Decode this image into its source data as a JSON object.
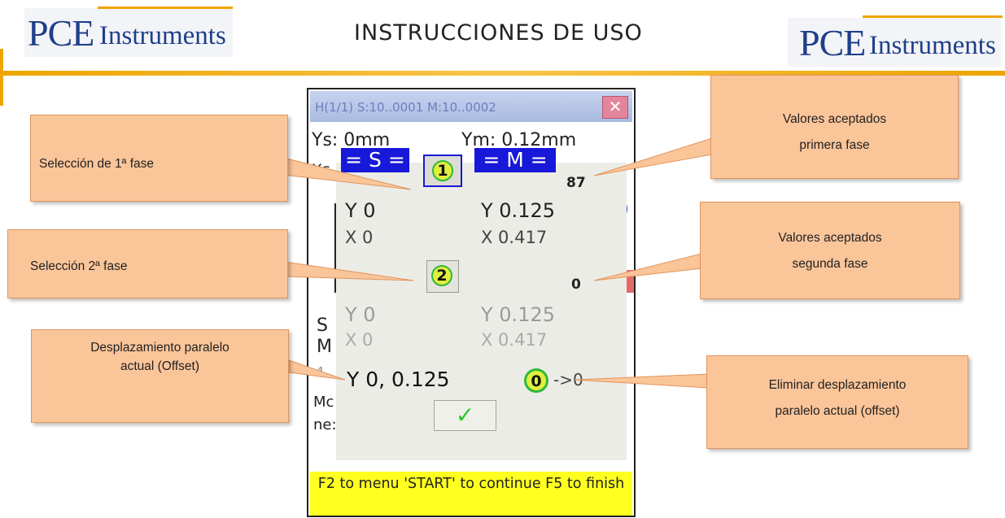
{
  "header": {
    "logo_left": {
      "main": "PCE",
      "sub": "Instruments"
    },
    "title": "INSTRUCCIONES DE USO",
    "logo_right": {
      "main": "PCE",
      "sub": "Instruments"
    }
  },
  "device": {
    "title_bar": "H(1/1) S:10..0001 M:10..0002",
    "close_glyph": "✕",
    "ys": "Ys: 0mm",
    "ym": "Ym: 0.12mm",
    "xs": "Xs",
    "side_s": "S",
    "side_m": "M",
    "side_4": "4.",
    "side_mo": "Mc",
    "side_ne": "ne:",
    "footer": "F2 to menu 'START' to continue F5 to finish",
    "colors": {
      "footer_bg": "#ffff20",
      "titlebar": "#b8c6e8"
    }
  },
  "dialog": {
    "s_label": "= S =",
    "m_label": "= M =",
    "phase1_number": "1",
    "phase1_count": "87",
    "phase1_y_s": "Y 0",
    "phase1_y_m": "Y 0.125",
    "phase1_x_s": "X 0",
    "phase1_x_m": "X 0.417",
    "phase2_number": "2",
    "phase2_count": "0",
    "phase2_y_s": "Y 0",
    "phase2_y_m": "Y 0.125",
    "phase2_x_s": "X 0",
    "phase2_x_m": "X 0.417",
    "offset_value": "Y 0, 0.125",
    "zero_label": "0",
    "zero_arrow": "->0",
    "confirm_glyph": "✓",
    "colors": {
      "blue_button": "#1818d8",
      "phase_circle": "#e0ef3c",
      "check": "#2ec62e"
    }
  },
  "callouts": {
    "phase1": "Selección de 1ª fase",
    "phase2": "Selección 2ª fase",
    "offset_line1": "Desplazamiento paralelo",
    "offset_line2": "actual (Offset)",
    "accepted1_line1": "Valores aceptados",
    "accepted1_line2": "primera fase",
    "accepted2_line1": "Valores aceptados",
    "accepted2_line2": "segunda fase",
    "delete_line1": "Eliminar desplazamiento",
    "delete_line2": "paralelo actual (offset)",
    "colors": {
      "fill": "#fbc59a",
      "border": "#e0955d"
    }
  }
}
